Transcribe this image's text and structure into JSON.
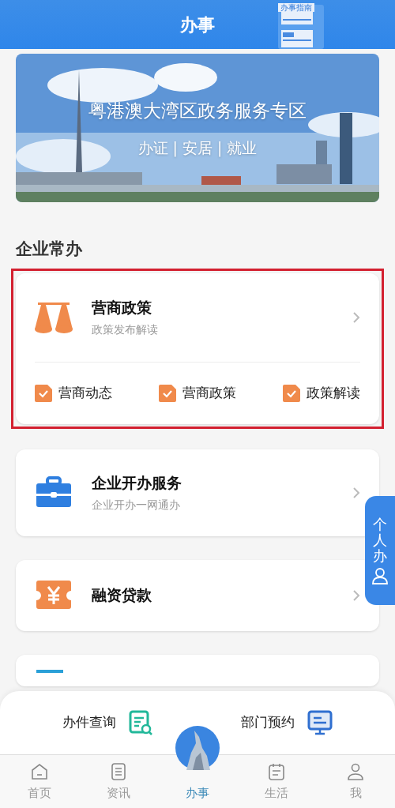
{
  "header": {
    "title": "办事",
    "guide_label": "办事指南"
  },
  "banner": {
    "kind": "picture",
    "title": "粤港澳大湾区政务服务专区",
    "subtitle": "办证 | 安居 | 就业"
  },
  "section_title": "企业常办",
  "cards": [
    {
      "kind": "scale",
      "title": "营商政策",
      "subtitle": "政策发布解读",
      "highlighted": true,
      "links": [
        "营商动态",
        "营商政策",
        "政策解读"
      ]
    },
    {
      "kind": "briefcase",
      "title": "企业开办服务",
      "subtitle": "企业开办一网通办",
      "highlighted": false
    },
    {
      "kind": "yuan",
      "title": "融资贷款",
      "highlighted": false
    },
    {
      "kind": "list",
      "highlighted": false
    }
  ],
  "side_tab": {
    "label": "个人办"
  },
  "quick_actions": [
    {
      "label": "办件查询",
      "kind": "query"
    },
    {
      "label": "部门预约",
      "kind": "booking"
    }
  ],
  "tabs": [
    {
      "label": "首页",
      "kind": "home",
      "selected": false
    },
    {
      "label": "资讯",
      "kind": "news",
      "selected": false
    },
    {
      "label": "办事",
      "kind": "services",
      "selected": true
    },
    {
      "label": "生活",
      "kind": "life",
      "selected": false
    },
    {
      "label": "我",
      "kind": "profile",
      "selected": false
    }
  ]
}
